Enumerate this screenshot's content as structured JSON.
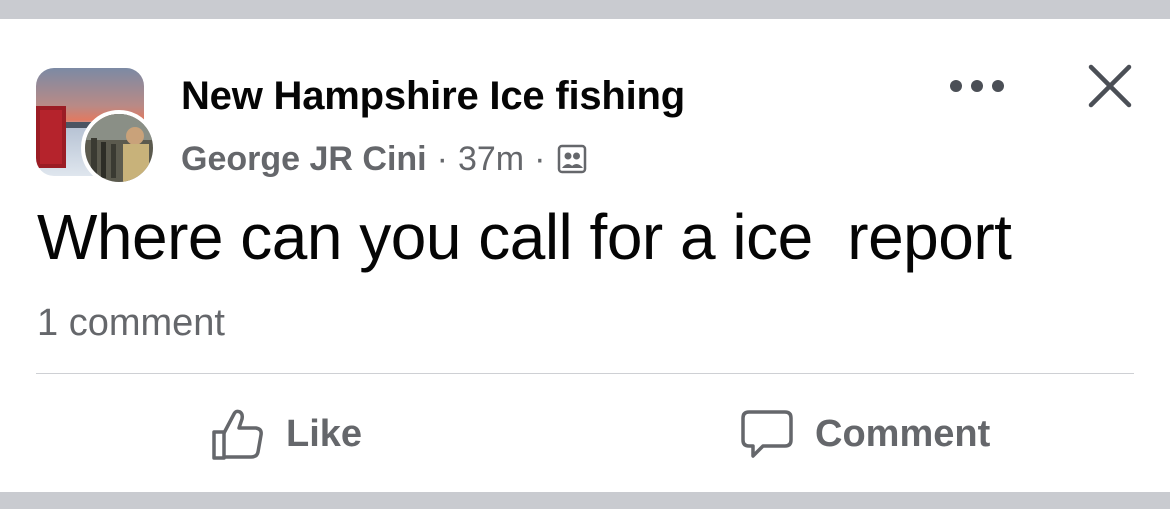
{
  "post": {
    "group_name": "New Hampshire Ice fishing",
    "author": "George JR Cini",
    "separator": "·",
    "time": "37m",
    "audience_icon": "group-audience-icon",
    "text": "Where can you call for a ice  report",
    "comment_count": "1 comment"
  },
  "header": {
    "more_icon": "more-horizontal-icon",
    "close_icon": "close-icon"
  },
  "actions": {
    "like_label": "Like",
    "like_icon": "thumbs-up-icon",
    "comment_label": "Comment",
    "comment_icon": "speech-bubble-icon"
  },
  "colors": {
    "primary_text": "#050505",
    "secondary_text": "#65676b",
    "divider": "#ced0d4",
    "background_band": "#c9cbd0"
  }
}
